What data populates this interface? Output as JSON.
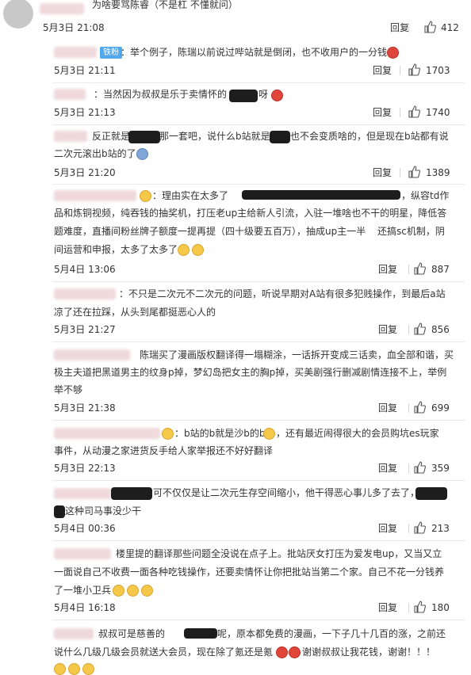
{
  "comments": [
    {
      "text_lines": [
        "为啥要骂陈睿（不是杠 不懂就问）"
      ],
      "date": "5月3日 21:08",
      "reply": "回复",
      "likes": "412"
    },
    {
      "badge": "铁粉",
      "text_lines": [
        "：举个例子，陈瑞以前说过哔站就是倒闭，也不收用户的一分钱"
      ],
      "date": "5月3日 21:11",
      "reply": "回复",
      "likes": "1703"
    },
    {
      "text_lines": [
        "：当然因为叔叔是乐于卖情怀的",
        "呀"
      ],
      "date": "5月3日 21:13",
      "reply": "回复",
      "likes": "1740"
    },
    {
      "text_lines": [
        "反正就是",
        "那一套吧，说什么b站就是",
        "也不会变质啥的，但是现在b站都有说",
        "二次元滚出b站的了"
      ],
      "date": "5月3日 21:20",
      "reply": "回复",
      "likes": "1389"
    },
    {
      "text_lines": [
        "：理由实在太多了",
        "，纵容td作",
        "品和炼铜视频，纯吞钱的抽奖机，打压老up主给新人引流，入驻一堆啥也不干的明星，降低答",
        "题难度，直播间粉丝牌子额度一提再提（四十级要五百万），抽成up主一半",
        "还搞sc机制，阴",
        "间运营和申报，太多了太多了"
      ],
      "date": "5月4日 13:06",
      "reply": "回复",
      "likes": "887"
    },
    {
      "text_lines": [
        "：不只是二次元不二次元的问题，听说早期对A站有很多犯贱操作，到最后a站",
        "凉了还在拉踩，从头到尾都挺恶心人的"
      ],
      "date": "5月3日 21:27",
      "reply": "回复",
      "likes": "856"
    },
    {
      "text_lines": [
        "陈瑞买了漫画版权翻译得一塌糊涂，一话拆开变成三话卖，血全部和谐，买",
        "极主夫道把黑道男主的纹身p掉，梦幻岛把女主的胸p掉，买美剧强行删减剧情连接不上，举例",
        "举不够"
      ],
      "date": "5月3日 21:38",
      "reply": "回复",
      "likes": "699"
    },
    {
      "text_lines": [
        "：b站的b就是沙b的b",
        "，还有最近闹得很大的会员购坑es玩家",
        "事件，从动漫之家进货反手给人家举报还不好好翻译"
      ],
      "date": "5月3日 22:13",
      "reply": "回复",
      "likes": "359"
    },
    {
      "text_lines": [
        "可不仅仅是让二次元生存空间缩小，他干得恶心事儿多了去了，",
        "这种司马事没少干"
      ],
      "date": "5月4日 00:36",
      "reply": "回复",
      "likes": "213"
    },
    {
      "text_lines": [
        "楼里提的翻译那些问题全没说在点子上。批站厌女打压为爱发电up，又当又立",
        "一面说自己不收费一面各种吃钱操作，还要卖情怀让你把批站当第二个家。自己不花一分钱养",
        "了一堆小卫兵"
      ],
      "date": "5月4日 16:18",
      "reply": "回复",
      "likes": "180"
    },
    {
      "text_lines": [
        "叔叔可是慈善的",
        "呢，原本都免费的漫画，一下子几十几百的涨，之前还",
        "说什么几级几级会员就送大会员，现在除了氪还是氪",
        "谢谢叔叔让我花钱，谢谢！！！"
      ]
    }
  ],
  "icons": {
    "like": "thumbs-up-icon",
    "emoji": "emoji-icon"
  },
  "colors": {
    "badge": "#52a8ec",
    "divider": "#eaeaea",
    "text": "#333333"
  }
}
